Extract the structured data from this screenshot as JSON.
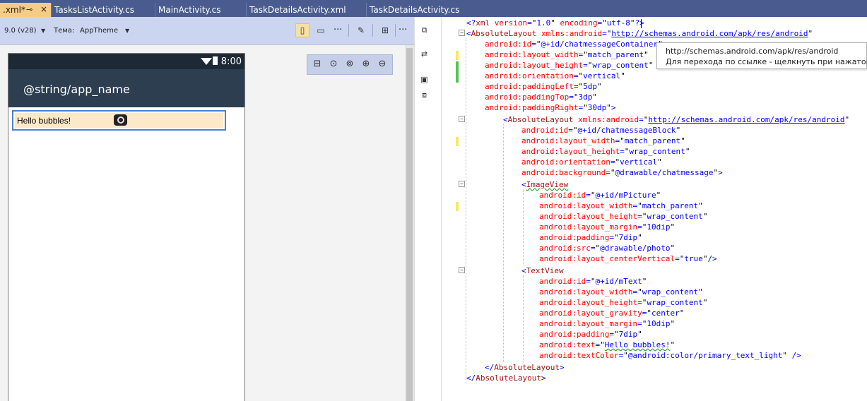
{
  "tabs": [
    {
      "label": ".xml*",
      "pin": "⊸",
      "close": "×"
    },
    {
      "label": "TasksListActivity.cs"
    },
    {
      "label": "MainActivity.cs"
    },
    {
      "label": "TaskDetailsActivity.xml"
    },
    {
      "label": "TaskDetailsActivity.cs"
    }
  ],
  "designer": {
    "api_level": "9.0 (v28)",
    "theme_label": "Тема:",
    "theme_value": "AppTheme",
    "more": "···",
    "device": {
      "time": "8:00",
      "app_title": "@string/app_name",
      "bubble_text": "Hello bubbles!"
    }
  },
  "tooltip": {
    "line1": "http://schemas.android.com/apk/res/android",
    "line2": "Для перехода по ссылке - щелкнуть при нажатой кл"
  },
  "code": [
    "<?xml version=\"1.0\" encoding=\"utf-8\"?>",
    "<AbsoluteLayout xmlns:android=\"http://schemas.android.com/apk/res/android\"",
    "android:id=\"@+id/chatmessageContainer\"",
    "android:layout_width=\"match_parent\"",
    "android:layout_height=\"wrap_content\"",
    "android:orientation=\"vertical\"",
    "android:paddingLeft=\"5dp\"",
    "android:paddingTop=\"3dp\"",
    "android:paddingRight=\"30dp\">",
    "<AbsoluteLayout xmlns:android=\"http://schemas.android.com/apk/res/android\"",
    "android:id=\"@+id/chatmessageBlock\"",
    "android:layout_width=\"match_parent\"",
    "android:layout_height=\"wrap_content\"",
    "android:orientation=\"vertical\"",
    "android:background=\"@drawable/chatmessage\">",
    "<ImageView",
    "android:id=\"@+id/mPicture\"",
    "android:layout_width=\"match_parent\"",
    "android:layout_height=\"wrap_content\"",
    "android:layout_margin=\"10dip\"",
    "android:padding=\"7dip\"",
    "android:src=\"@drawable/photo\"",
    "android:layout_centerVertical=\"true\"/>",
    "<TextView",
    "android:id=\"@+id/mText\"",
    "android:layout_width=\"wrap_content\"",
    "android:layout_height=\"wrap_content\"",
    "android:layout_gravity=\"center\"",
    "android:layout_margin=\"10dip\"",
    "android:padding=\"7dip\"",
    "android:text=\"Hello bubbles!\"",
    "android:textColor=\"@android:color/primary_text_light\" />",
    "</AbsoluteLayout>",
    "</AbsoluteLayout>"
  ],
  "colors": {
    "tab_bar": "#4a5c8f",
    "active_tab": "#f5cc84",
    "app_bar": "#2c3e50",
    "bubble_bg": "#fde8c8",
    "selection_border": "#4d7fd9"
  }
}
